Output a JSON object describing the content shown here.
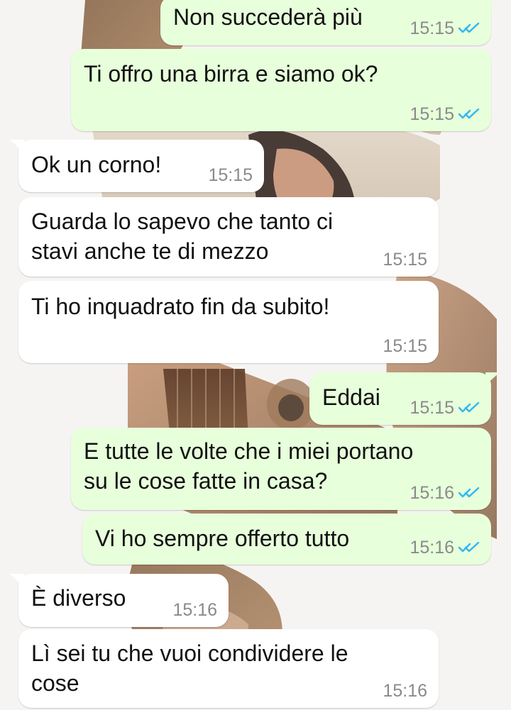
{
  "colors": {
    "outgoing_bubble": "#e7ffdb",
    "incoming_bubble": "#ffffff",
    "read_receipt": "#34b7f1",
    "timestamp": "#8a8a8a"
  },
  "icons": {
    "read_receipt": "double-check-icon"
  },
  "messages": [
    {
      "direction": "outgoing",
      "text": "Non succederà più",
      "time": "15:15",
      "read": true
    },
    {
      "direction": "outgoing",
      "text": "Ti offro una birra e siamo ok?",
      "time": "15:15",
      "read": true
    },
    {
      "direction": "incoming",
      "text": "Ok un corno!",
      "time": "15:15"
    },
    {
      "direction": "incoming",
      "text": "Guarda lo sapevo che tanto ci\nstavi anche te di mezzo",
      "time": "15:15"
    },
    {
      "direction": "incoming",
      "text": "Ti ho inquadrato fin da subito!",
      "time": "15:15"
    },
    {
      "direction": "outgoing",
      "text": "Eddai",
      "time": "15:15",
      "read": true
    },
    {
      "direction": "outgoing",
      "text": "E tutte le volte che i miei portano\nsu le cose fatte in casa?",
      "time": "15:16",
      "read": true
    },
    {
      "direction": "outgoing",
      "text": "Vi ho sempre offerto tutto",
      "time": "15:16",
      "read": true
    },
    {
      "direction": "incoming",
      "text": "È diverso",
      "time": "15:16"
    },
    {
      "direction": "incoming",
      "text": "Lì sei tu che vuoi condividere le\ncose",
      "time": "15:16"
    }
  ]
}
